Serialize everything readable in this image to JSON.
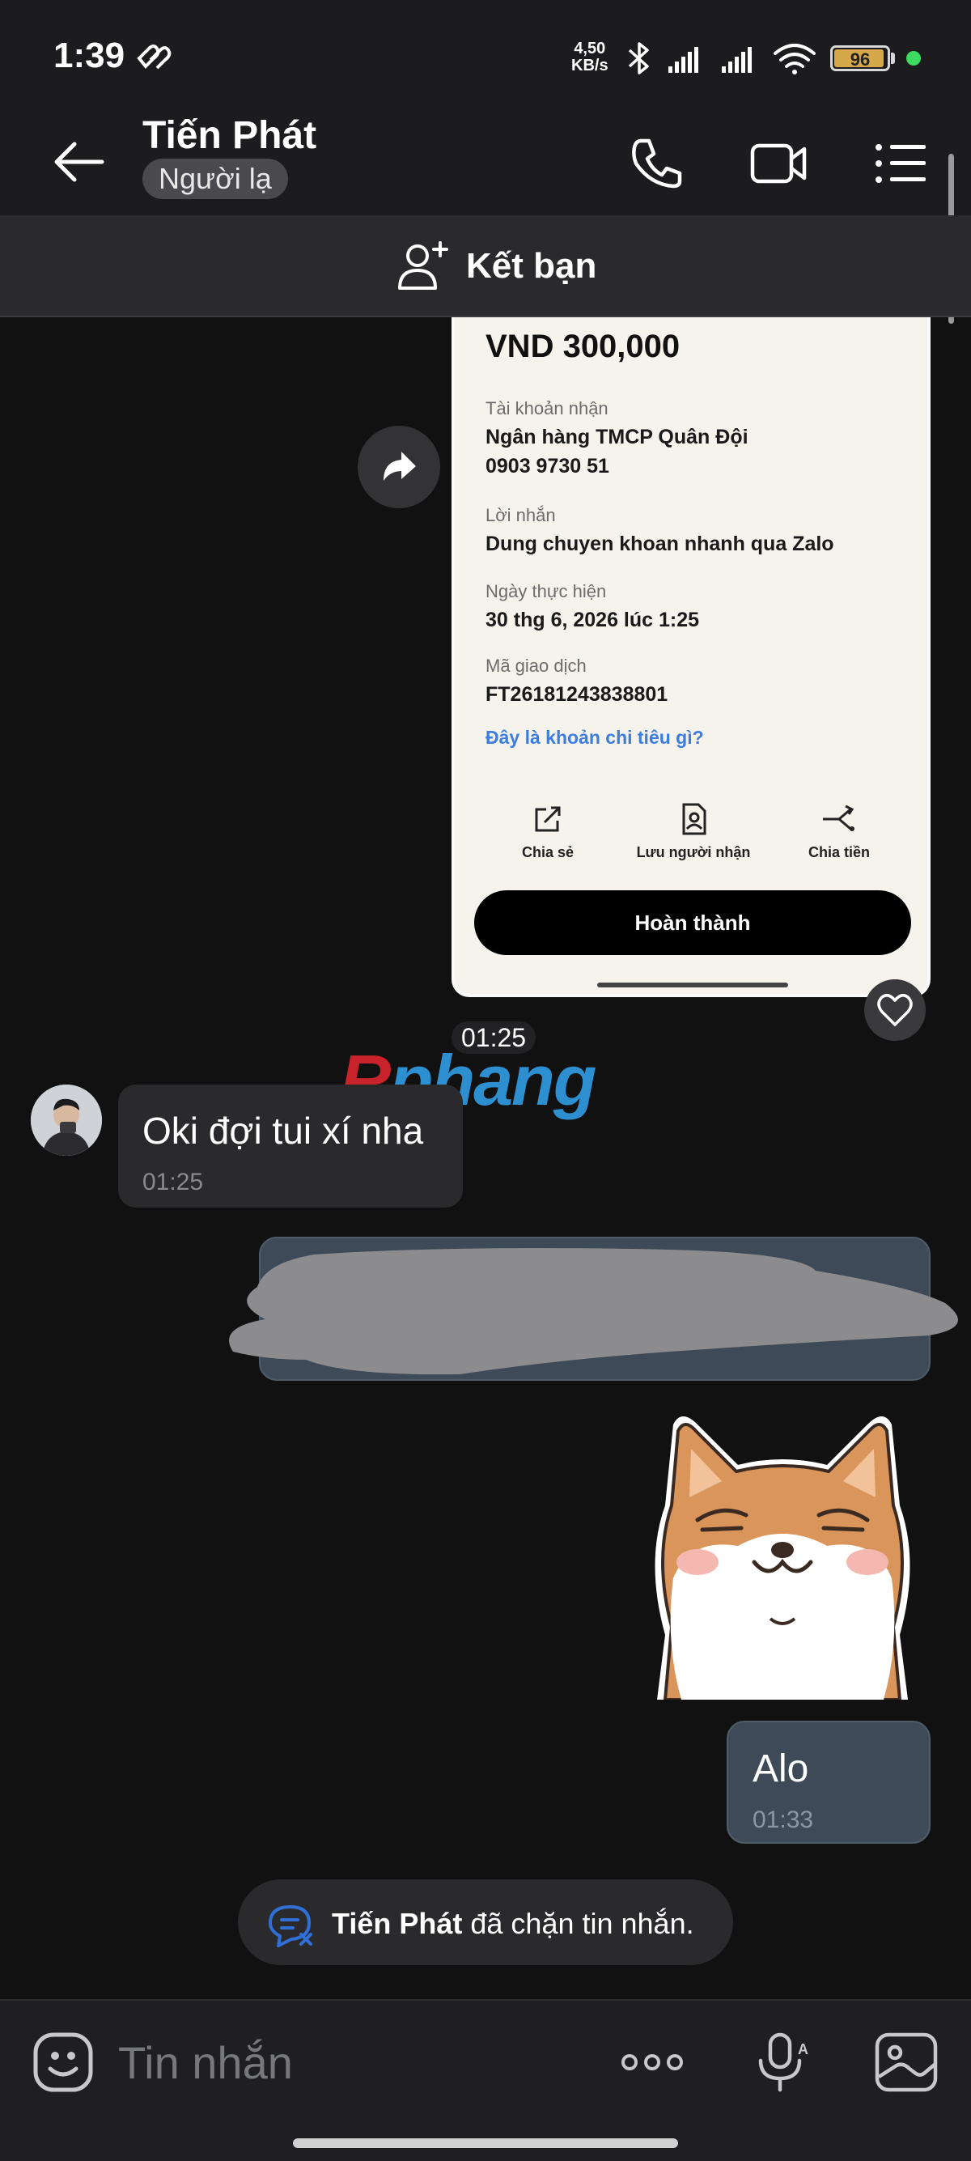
{
  "status_bar": {
    "time": "1:39",
    "net_speed_value": "4,50",
    "net_speed_unit": "KB/s",
    "battery_level": "96",
    "battery_percent": 96
  },
  "header": {
    "contact_name": "Tiến Phát",
    "relation_badge": "Người lạ"
  },
  "add_friend": {
    "label": "Kết bạn"
  },
  "receipt": {
    "amount": "VND 300,000",
    "account_label": "Tài khoản nhận",
    "bank_name": "Ngân hàng TMCP Quân Đội",
    "account_number": "0903 9730 51",
    "message_label": "Lời nhắn",
    "message_value": "Dung chuyen khoan nhanh qua Zalo",
    "date_label": "Ngày thực hiện",
    "date_value": "30 thg 6, 2026 lúc 1:25",
    "txid_label": "Mã giao dịch",
    "txid_value": "FT26181243838801",
    "category_link": "Đây là khoản chi tiêu gì?",
    "actions": [
      {
        "label": "Chia sẻ",
        "icon": "share-icon"
      },
      {
        "label": "Lưu người nhận",
        "icon": "save-recipient-icon"
      },
      {
        "label": "Chia tiền",
        "icon": "split-money-icon"
      }
    ],
    "done_button": "Hoàn thành"
  },
  "image_time": "01:25",
  "watermark": {
    "part1": "R",
    "part2": "phang"
  },
  "messages": {
    "incoming": {
      "text": "Oki đợi tui xí nha",
      "time": "01:25"
    },
    "outgoing": {
      "text": "Alo",
      "time": "01:33"
    }
  },
  "blocked_notice": {
    "name": "Tiến Phát",
    "text": " đã chặn tin nhắn."
  },
  "input": {
    "placeholder": "Tin nhắn"
  },
  "colors": {
    "background": "#111111",
    "header": "#1c1c1e",
    "outgoing_bubble": "#3e4a57",
    "incoming_bubble": "#2a2a2c",
    "link_blue": "#3d7de0",
    "blocked_icon_blue": "#2f6fd6"
  }
}
